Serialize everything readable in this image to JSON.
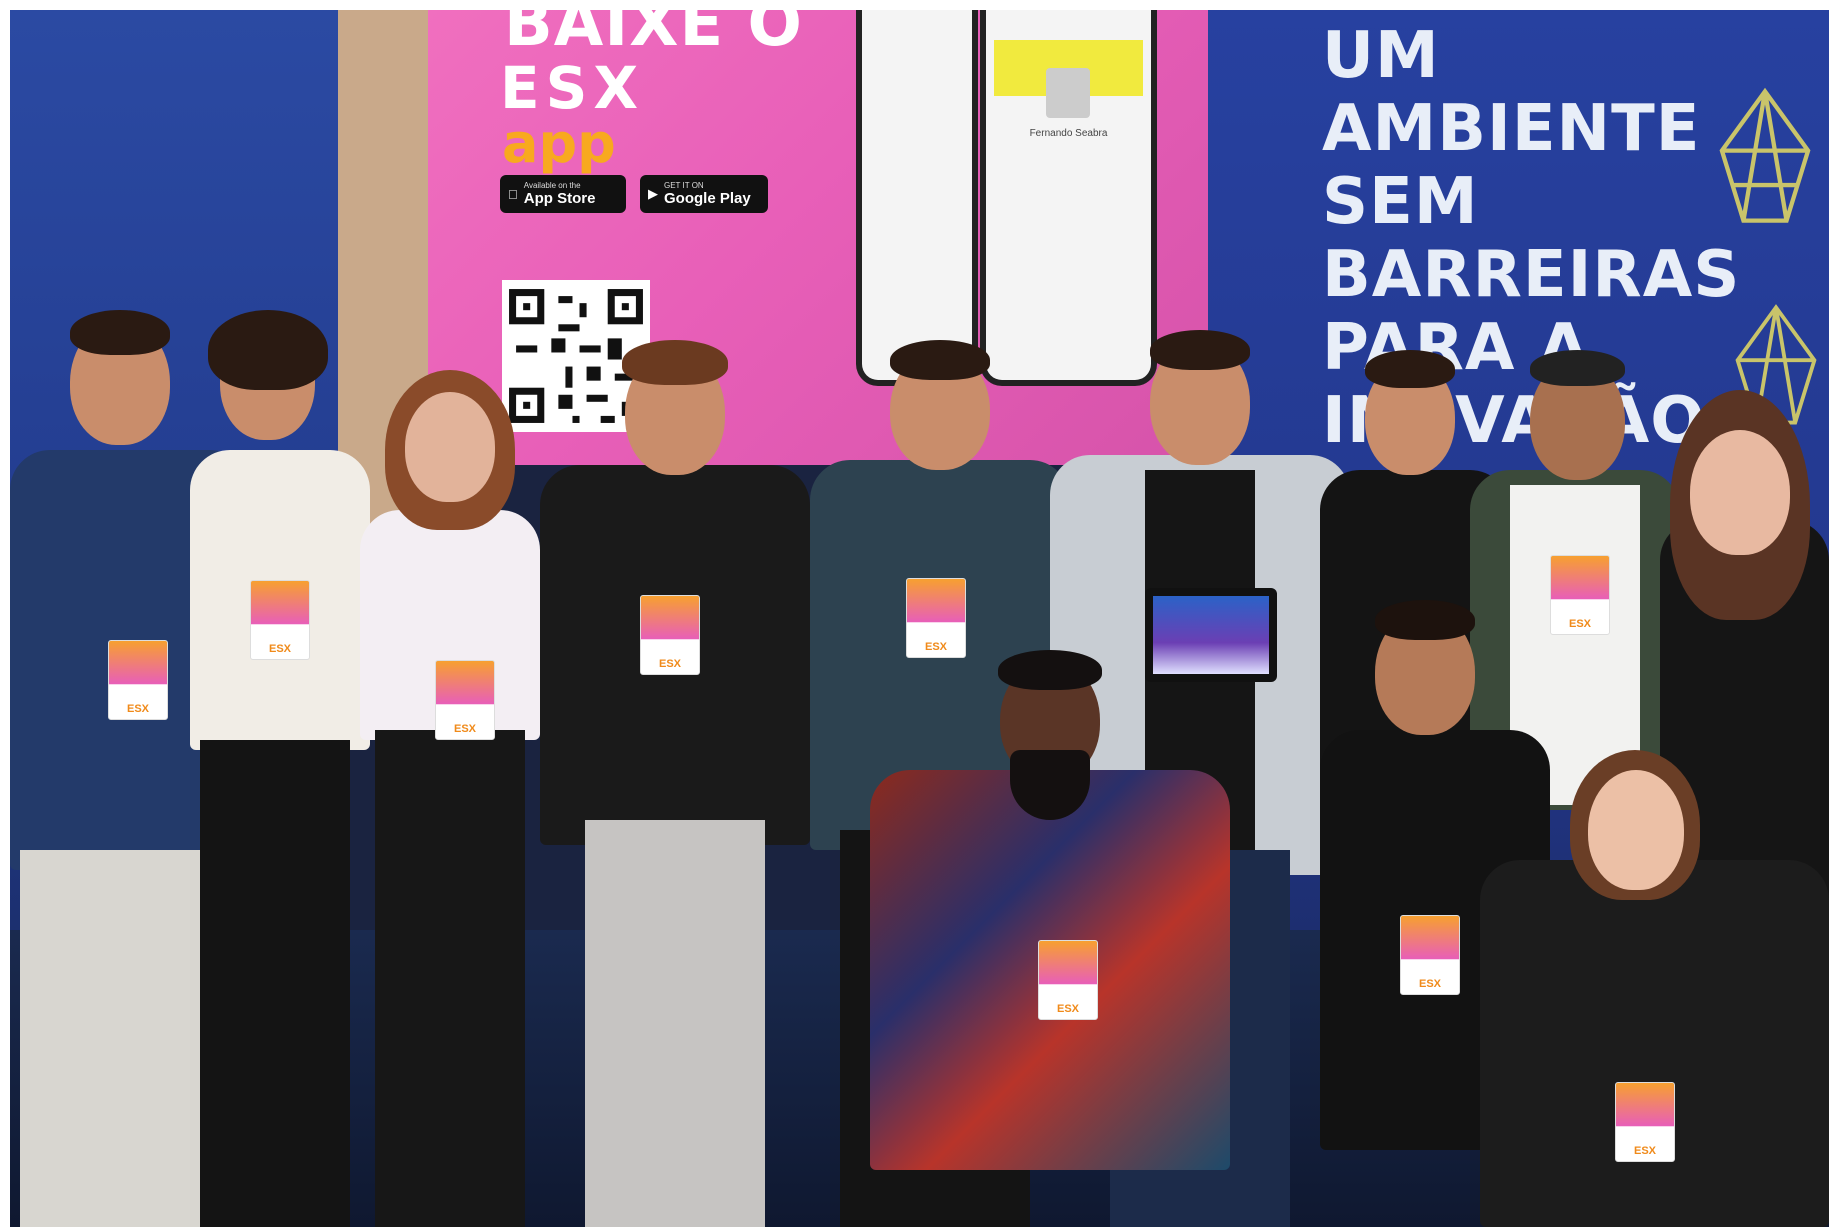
{
  "screen": {
    "title_partial": "BAIXE O",
    "logo": "ESX",
    "app": "app",
    "app_store": {
      "small": "Available on the",
      "big": "App Store"
    },
    "google_play": {
      "small": "GET IT ON",
      "big": "Google Play"
    }
  },
  "phone_profile_name": "Fernando Seabra",
  "slogan": {
    "line1": "UM",
    "line2": "AMBIENTE",
    "line3": "SEM",
    "line4": "BARREIRAS",
    "line5": "PARA A",
    "line6": "INOVAÇÃO"
  },
  "colors": {
    "wall_blue": "#2741a0",
    "screen_pink": "#e85fb8",
    "accent_orange": "#f8a91f",
    "slogan_text": "#e8eef8"
  }
}
